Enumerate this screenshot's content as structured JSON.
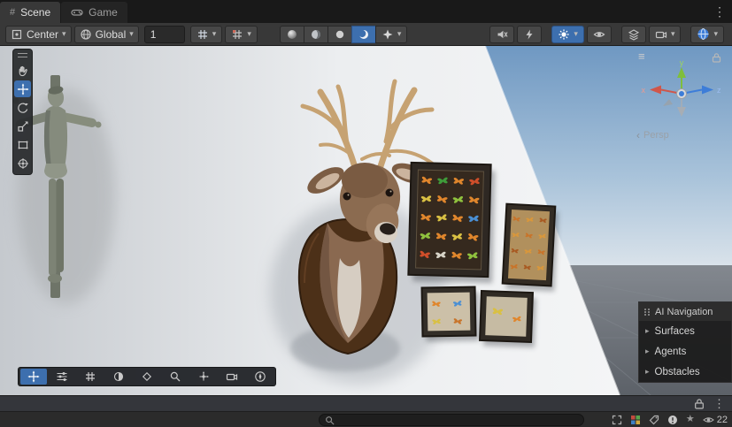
{
  "tabs": {
    "scene_label": "Scene",
    "game_label": "Game"
  },
  "toolbar": {
    "pivot_label": "Center",
    "orientation_label": "Global",
    "snap_value": "1"
  },
  "gizmo": {
    "x_label": "x",
    "y_label": "y",
    "z_label": "z",
    "projection_label": "Persp"
  },
  "ai_navigation": {
    "title": "AI Navigation",
    "items": [
      {
        "label": "Surfaces"
      },
      {
        "label": "Agents"
      },
      {
        "label": "Obstacles"
      }
    ]
  },
  "statusbar": {
    "search_placeholder": "",
    "visible_count": "22"
  },
  "icons": {
    "hash": "#",
    "caret_down": "▾",
    "kebab": "⋮",
    "hamburger": "≡",
    "foldout": "▸",
    "star": "★",
    "collapse": "‹"
  },
  "colors": {
    "accent_blue": "#3d6fae",
    "axis_x": "#d0564a",
    "axis_y": "#7fbe3c",
    "axis_z": "#3d7dd8"
  }
}
